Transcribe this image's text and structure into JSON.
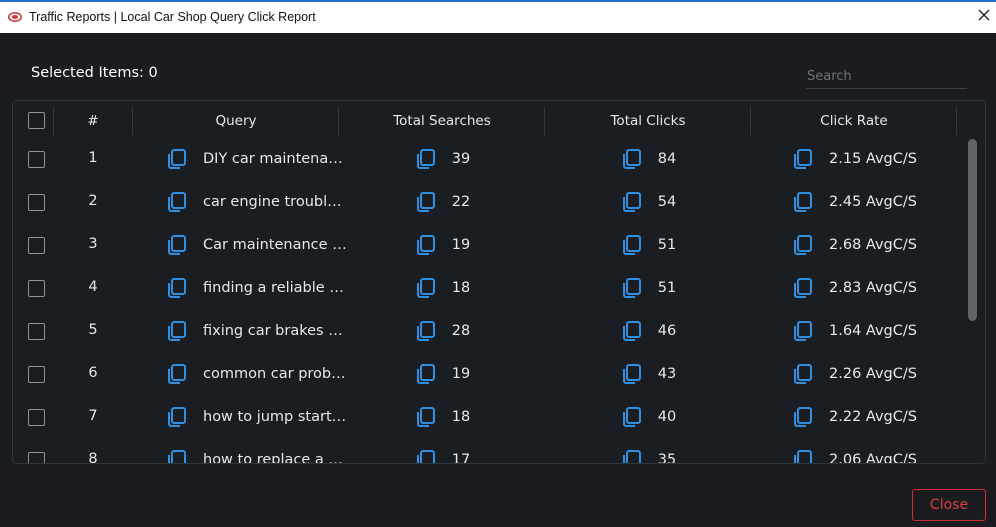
{
  "window": {
    "title": "Traffic Reports | Local Car Shop Query Click Report"
  },
  "selection": {
    "label": "Selected Items: 0"
  },
  "search": {
    "placeholder": "Search",
    "value": ""
  },
  "table": {
    "columns": [
      "#",
      "Query",
      "Total Searches",
      "Total Clicks",
      "Click Rate"
    ],
    "rows": [
      {
        "num": "1",
        "query": "DIY car maintenance tips",
        "searches": "39",
        "clicks": "84",
        "rate": "2.15 AvgC/S"
      },
      {
        "num": "2",
        "query": "car engine troubleshooting",
        "searches": "22",
        "clicks": "54",
        "rate": "2.45 AvgC/S"
      },
      {
        "num": "3",
        "query": "Car maintenance checklist",
        "searches": "19",
        "clicks": "51",
        "rate": "2.68 AvgC/S"
      },
      {
        "num": "4",
        "query": "finding a reliable mechanic",
        "searches": "18",
        "clicks": "51",
        "rate": "2.83 AvgC/S"
      },
      {
        "num": "5",
        "query": "fixing car brakes at home",
        "searches": "28",
        "clicks": "46",
        "rate": "1.64 AvgC/S"
      },
      {
        "num": "6",
        "query": "common car problems",
        "searches": "19",
        "clicks": "43",
        "rate": "2.26 AvgC/S"
      },
      {
        "num": "7",
        "query": "how to jump start a car",
        "searches": "18",
        "clicks": "40",
        "rate": "2.22 AvgC/S"
      },
      {
        "num": "8",
        "query": "how to replace a tire",
        "searches": "17",
        "clicks": "35",
        "rate": "2.06 AvgC/S"
      }
    ]
  },
  "footer": {
    "close_label": "Close"
  },
  "colors": {
    "background": "#1a1c20",
    "accent_icon": "#2f8fe0",
    "border": "#2a3a40",
    "close": "#dc3b45"
  },
  "icons": {
    "app": "traffic-logo-icon",
    "window_close": "close-icon",
    "copy": "copy-icon"
  }
}
